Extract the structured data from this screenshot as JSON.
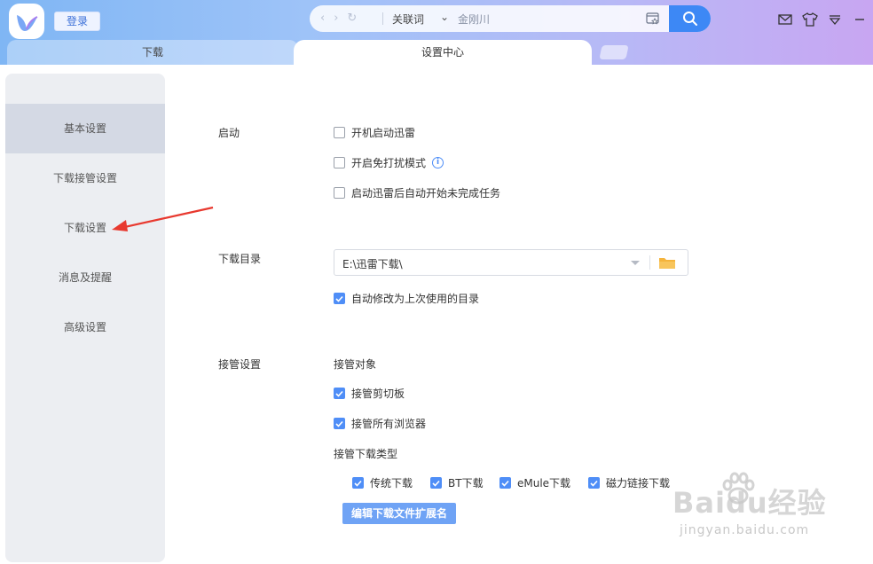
{
  "header": {
    "login_label": "登录",
    "search_mode": "关联词",
    "search_value": "金刚川"
  },
  "tabs": [
    {
      "label": "下载"
    },
    {
      "label": "设置中心"
    }
  ],
  "sidebar": {
    "items": [
      {
        "label": "基本设置",
        "active": true
      },
      {
        "label": "下载接管设置"
      },
      {
        "label": "下载设置"
      },
      {
        "label": "消息及提醒"
      },
      {
        "label": "高级设置"
      }
    ]
  },
  "startup": {
    "section_label": "启动",
    "options": [
      {
        "label": "开机启动迅雷",
        "checked": false
      },
      {
        "label": "开启免打扰模式",
        "checked": false
      },
      {
        "label": "启动迅雷后自动开始未完成任务",
        "checked": false
      }
    ]
  },
  "download_dir": {
    "section_label": "下载目录",
    "path": "E:\\迅雷下载\\",
    "auto_modify_label": "自动修改为上次使用的目录",
    "auto_modify_checked": true
  },
  "takeover": {
    "section_label": "接管设置",
    "targets_label": "接管对象",
    "targets": [
      {
        "label": "接管剪切板",
        "checked": true
      },
      {
        "label": "接管所有浏览器",
        "checked": true
      }
    ],
    "types_label": "接管下载类型",
    "types": [
      {
        "label": "传统下载",
        "checked": true
      },
      {
        "label": "BT下载",
        "checked": true
      },
      {
        "label": "eMule下载",
        "checked": true
      },
      {
        "label": "磁力链接下载",
        "checked": true
      }
    ],
    "edit_button_label": "编辑下载文件扩展名"
  },
  "watermark": {
    "main": "Baidu经验",
    "sub": "jingyan.baidu.com"
  },
  "colors": {
    "accent": "#4f8ef7",
    "search_button": "#3d88f5",
    "annotation_arrow": "#e8392f"
  }
}
